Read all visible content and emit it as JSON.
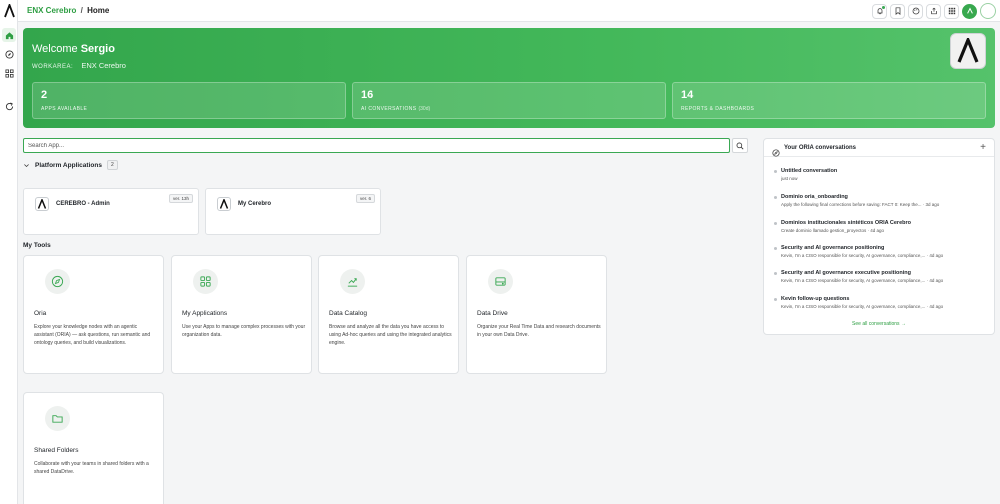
{
  "breadcrumb": {
    "brand": "ENX Cerebro",
    "separator": "/",
    "page": "Home"
  },
  "rail": {
    "items": [
      "home-icon",
      "compass-icon",
      "grid-icon",
      "refresh-icon"
    ]
  },
  "topbar": {
    "icons": [
      "bell-icon",
      "bookmark-icon",
      "palette-icon",
      "share-icon",
      "apps-grid-icon",
      "user-icon",
      "avatar"
    ]
  },
  "hero": {
    "welcome": "Welcome",
    "user": "Sergio",
    "workarea_label": "WORKAREA:",
    "workarea_value": "ENX Cerebro",
    "stats": [
      {
        "value": "2",
        "label": "APPS AVAILABLE",
        "suffix": ""
      },
      {
        "value": "16",
        "label": "AI CONVERSATIONS",
        "suffix": "(30d)"
      },
      {
        "value": "14",
        "label": "REPORTS & DASHBOARDS",
        "suffix": ""
      }
    ]
  },
  "search": {
    "placeholder": "Search App..."
  },
  "platform": {
    "title": "Platform Applications",
    "count": "2",
    "apps": [
      {
        "name": "CEREBRO - Admin",
        "version": "ver. 13h"
      },
      {
        "name": "My Cerebro",
        "version": "ver. 6"
      }
    ]
  },
  "tools": {
    "title": "My Tools",
    "items": [
      {
        "name": "Oria",
        "icon": "compass-icon",
        "desc": "Explore your knowledge nodes with an agentic assistant (ORIA) — ask questions, run semantic and ontology queries, and build visualizations."
      },
      {
        "name": "My Applications",
        "icon": "apps-grid-icon",
        "desc": "Use your Apps to manage complex processes with your organization data."
      },
      {
        "name": "Data Catalog",
        "icon": "chart-icon",
        "desc": "Browse and analyze all the data you have access to using Ad-hoc queries and using the integrated analytics engine."
      },
      {
        "name": "Data Drive",
        "icon": "drive-icon",
        "desc": "Organize your Real Time Data and research documents in your own Data Drive."
      },
      {
        "name": "Shared Folders",
        "icon": "folder-icon",
        "desc": "Collaborate with your teams in shared folders with a shared DataDrive."
      }
    ]
  },
  "conversations": {
    "title": "Your ORIA conversations",
    "add": "+",
    "items": [
      {
        "title": "Untitled conversation",
        "sub": "just now"
      },
      {
        "title": "Dominio oria_onboarding",
        "sub": "Apply the following final corrections before saving: FACT 0: Keep the... · 3d ago"
      },
      {
        "title": "Dominios institucionales sintéticos ORIA Cerebro",
        "sub": "Create dominio llamado gestion_proyectos · 4d ago"
      },
      {
        "title": "Security and AI governance positioning",
        "sub": "Kevin, I'm a CISO responsible for security, AI governance, compliance,... · 4d ago"
      },
      {
        "title": "Security and AI governance executive positioning",
        "sub": "Kevin, I'm a CISO responsible for security, AI governance, compliance,... · 4d ago"
      },
      {
        "title": "Kevin follow-up questions",
        "sub": "Kevin, I'm a CISO responsible for security, AI governance, compliance,... · 4d ago"
      }
    ],
    "see_all": "See all conversations →"
  },
  "colors": {
    "accent": "#38a84e",
    "hero_start": "#33a64c",
    "hero_end": "#55c26b"
  }
}
